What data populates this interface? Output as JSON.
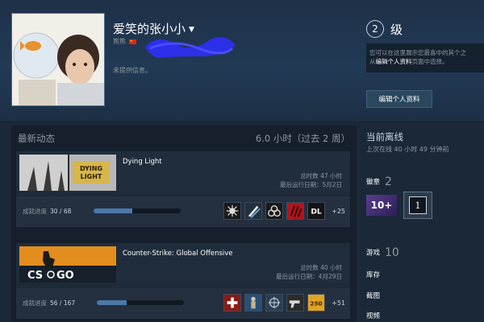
{
  "profile": {
    "persona_name": "爱笑的张小小",
    "real_name_prefix": "熊熊",
    "no_info": "未提供信息。",
    "level_number": "2",
    "level_label": "级",
    "showcase_line1": "您可以在这里展示您最喜中的其个之",
    "showcase_line2_prefix": "从",
    "showcase_line2_link": "编辑个人资料",
    "showcase_line2_suffix": "页面中选择。",
    "edit_button": "编辑个人资料"
  },
  "activity": {
    "title": "最新动态",
    "hours_summary": "6.0 小时（过去 2 周）",
    "games": [
      {
        "name": "Dying Light",
        "total_hours": "总时数 47 小时",
        "last_played": "最后运行日期：5月2日",
        "ach_label": "成就进度",
        "ach_count": "30 / 68",
        "ach_progress": 0.44,
        "more": "+25",
        "icons": [
          "atom-achievement-icon",
          "claw-achievement-icon",
          "biohazard-achievement-icon",
          "scratch-achievement-icon",
          "dl-achievement-icon"
        ]
      },
      {
        "name": "Counter-Strike: Global Offensive",
        "total_hours": "总时数 40 小时",
        "last_played": "最后运行日期：4月29日",
        "ach_label": "成就进度",
        "ach_count": "56 / 167",
        "ach_progress": 0.34,
        "more": "+51",
        "icons": [
          "medic-achievement-icon",
          "soldier-achievement-icon",
          "target-achievement-icon",
          "pistol-achievement-icon",
          "cash-achievement-icon"
        ]
      }
    ]
  },
  "sidebar": {
    "status_title": "当前离线",
    "last_online": "上次在线 40 小时 49 分钟前",
    "badges_label": "徽章",
    "badges_count": "2",
    "badge_level_text": "10+",
    "badge_one_text": "1",
    "games_label": "游戏",
    "games_count": "10",
    "library_label": "库存",
    "screenshots_label": "截图",
    "videos_label": "视频"
  },
  "colors": {
    "background": "#1b2838",
    "accent": "#4a79a8",
    "text": "#c7d5e0"
  }
}
